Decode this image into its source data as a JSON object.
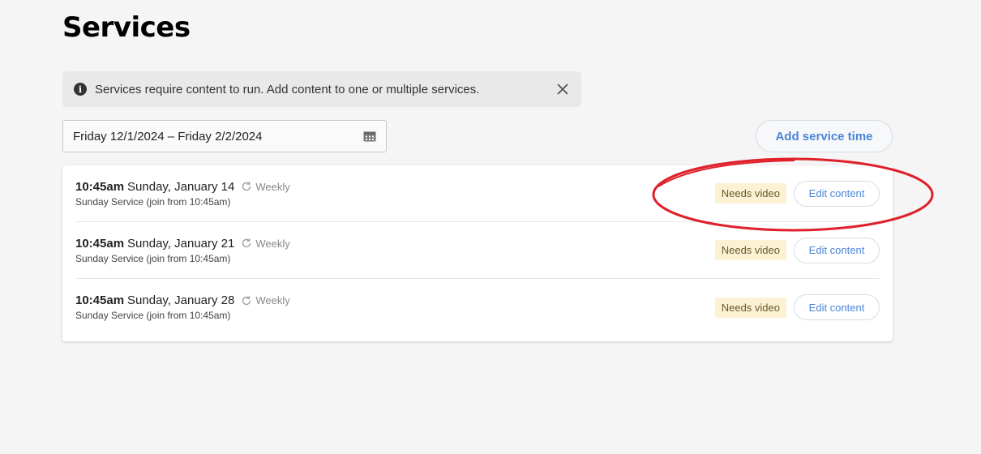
{
  "header": {
    "title": "Services"
  },
  "notice": {
    "text": "Services require content to run. Add content to one or multiple services.",
    "icon": "info-icon",
    "close_icon": "close-icon"
  },
  "date_filter": {
    "value": "Friday 12/1/2024 – Friday 2/2/2024",
    "icon": "calendar-icon"
  },
  "actions": {
    "add_service_label": "Add service time"
  },
  "services": [
    {
      "time": "10:45am",
      "date": "Sunday, January 14",
      "recurrence": "Weekly",
      "subtitle": "Sunday Service (join from 10:45am)",
      "status": "Needs video",
      "edit_label": "Edit content"
    },
    {
      "time": "10:45am",
      "date": "Sunday, January 21",
      "recurrence": "Weekly",
      "subtitle": "Sunday Service (join from 10:45am)",
      "status": "Needs video",
      "edit_label": "Edit content"
    },
    {
      "time": "10:45am",
      "date": "Sunday, January 28",
      "recurrence": "Weekly",
      "subtitle": "Sunday Service (join from 10:45am)",
      "status": "Needs video",
      "edit_label": "Edit content"
    }
  ],
  "colors": {
    "accent": "#4a86d8",
    "badge_bg": "#fbf1d3",
    "annotation": "#e0202a"
  }
}
